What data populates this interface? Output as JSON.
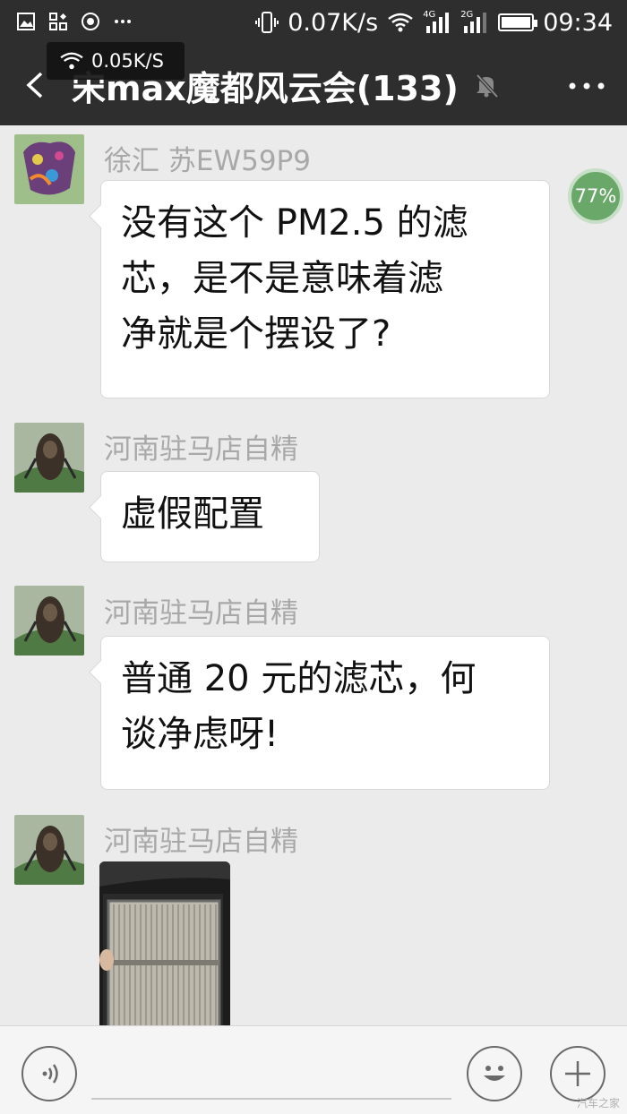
{
  "status_bar": {
    "net_speed": "0.07K/s",
    "net_4g": "4G",
    "net_2g": "2G",
    "time": "09:34"
  },
  "header": {
    "title": "宋max魔都风云会(133)",
    "net_overlay": "0.05K/S"
  },
  "battery_float": "77%",
  "messages": [
    {
      "sender": "徐汇 苏EW59P9",
      "lines": [
        "没有这个 PM2.5 的滤",
        "芯，是不是意味着滤",
        "净就是个摆设了?"
      ]
    },
    {
      "sender": "河南驻马店自精",
      "lines": [
        "虚假配置"
      ]
    },
    {
      "sender": "河南驻马店自精",
      "lines": [
        "普通 20 元的滤芯，何",
        "谈净虑呀!"
      ]
    },
    {
      "sender": "河南驻马店自精",
      "image": "air-filter-photo"
    }
  ],
  "input_bar": {
    "watermark": "汽车之家"
  },
  "colors": {
    "header_bg": "#2e2e2e",
    "chat_bg": "#ebebeb",
    "bubble_bg": "#ffffff",
    "sender_text": "#a8a8a8"
  }
}
